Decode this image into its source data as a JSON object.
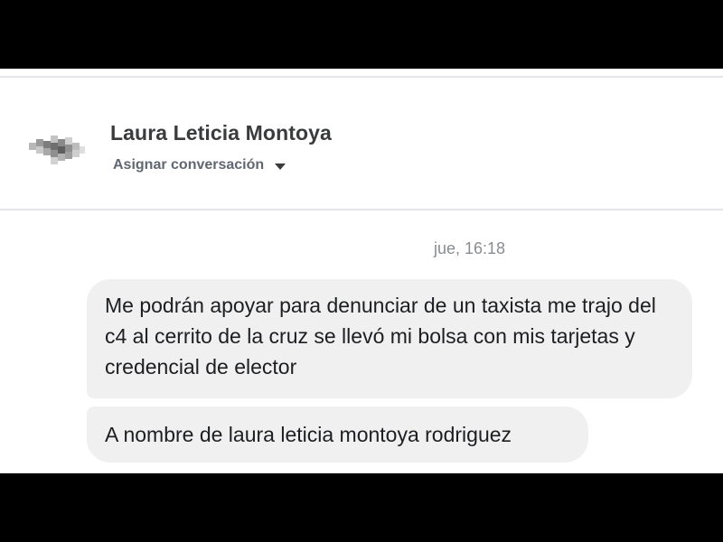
{
  "conversation": {
    "contact_name": "Laura Leticia Montoya",
    "assign_label": "Asignar conversación",
    "timestamp": "jue, 16:18",
    "messages": [
      "Me podrán apoyar para denunciar de un taxista me trajo del c4 al cerrito de la cruz  se llevó mi bolsa con mis tarjetas y credencial de elector",
      "A nombre de laura leticia montoya rodriguez"
    ]
  },
  "icons": {
    "avatar": "blurred-avatar-icon",
    "assign_dropdown": "caret-down-icon"
  },
  "colors": {
    "bubble_background": "#f0f0f0",
    "name_text": "#3a3b3c",
    "secondary_text": "#606770",
    "timestamp_text": "#8a8d91",
    "divider": "#e4e6eb"
  }
}
